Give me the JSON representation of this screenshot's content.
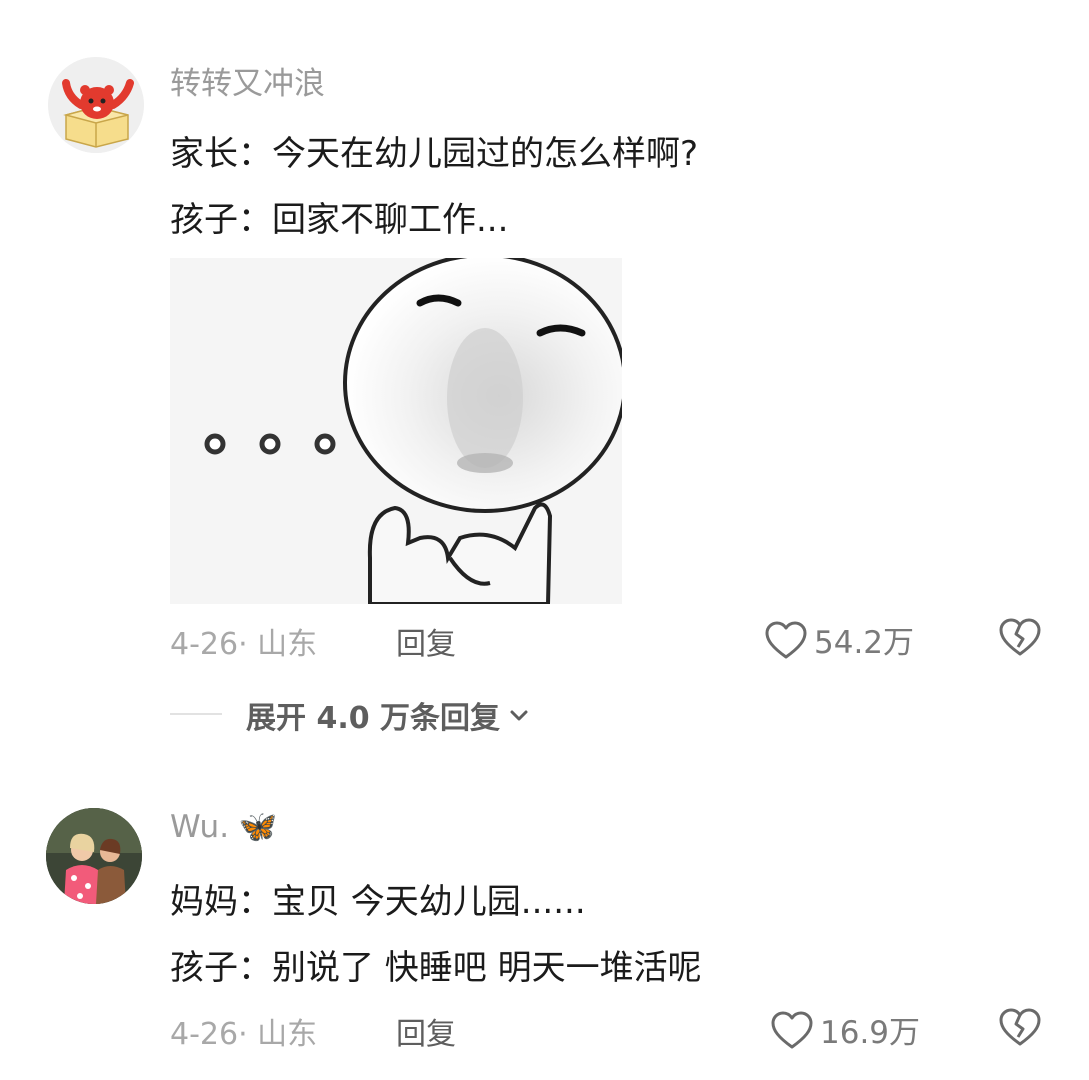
{
  "comments": [
    {
      "username": "转转又冲浪",
      "lines": [
        "家长：今天在幼儿园过的怎么样啊?",
        "孩子：回家不聊工作..."
      ],
      "meta": "4-26· 山东",
      "reply_label": "回复",
      "likes": "54.2万",
      "icons": {
        "avatar": "red-bear-in-box-avatar",
        "like": "heart-icon",
        "dislike": "broken-heart-icon"
      }
    },
    {
      "username": "Wu.",
      "username_emoji": "🦋",
      "lines": [
        "妈妈：宝贝 今天幼儿园......",
        "孩子：别说了 快睡吧 明天一堆活呢"
      ],
      "meta": "4-26· 山东",
      "reply_label": "回复",
      "likes": "16.9万",
      "icons": {
        "avatar": "two-girls-photo-avatar",
        "like": "heart-icon",
        "dislike": "broken-heart-icon"
      }
    }
  ],
  "expand_replies": {
    "label": "展开 4.0 万条回复",
    "icon": "chevron-down-icon"
  },
  "colors": {
    "text": "#1b1b1b",
    "muted": "#9a9a9a",
    "icon": "#6a6a6a",
    "avatar_red": "#e23a2e"
  }
}
